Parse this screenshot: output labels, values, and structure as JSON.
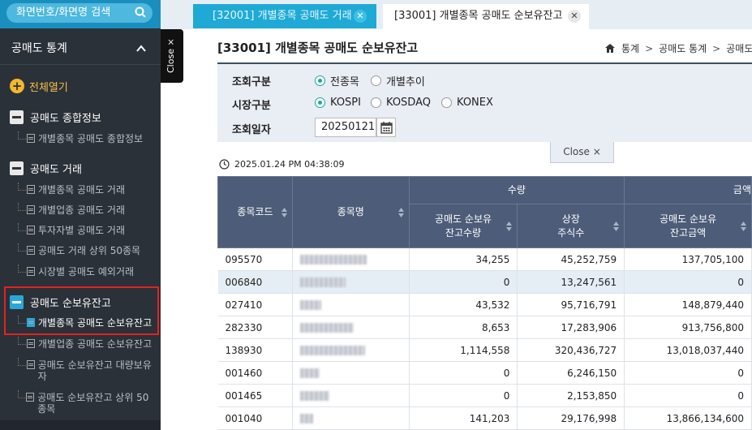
{
  "sidebar": {
    "search_placeholder": "화면번호/화면명 검색",
    "title": "공매도 통계",
    "expand_all": "전체열기",
    "groups": [
      {
        "label": "공매도 종합정보",
        "items": [
          "개별종목 공매도 종합정보"
        ]
      },
      {
        "label": "공매도 거래",
        "items": [
          "개별종목 공매도 거래",
          "개별업종 공매도 거래",
          "투자자별 공매도 거래",
          "공매도 거래 상위 50종목",
          "시장별 공매도 예외거래"
        ]
      },
      {
        "label": "공매도 순보유잔고",
        "items": [
          "개별종목 공매도 순보유잔고",
          "개별업종 공매도 순보유잔고",
          "공매도 순보유잔고 대량보유자",
          "공매도 순보유잔고 상위 50종목"
        ]
      }
    ]
  },
  "close_vertical": "Close ×",
  "tabs": [
    {
      "label": "[32001] 개별종목 공매도 거래"
    },
    {
      "label": "[33001] 개별종목 공매도 순보유잔고"
    }
  ],
  "page": {
    "title": "[33001] 개별종목 공매도 순보유잔고",
    "breadcrumb": [
      "통계",
      "공매도 통계",
      "공매도"
    ]
  },
  "filter": {
    "query_type_label": "조회구분",
    "query_type_options": [
      "전종목",
      "개별추이"
    ],
    "market_label": "시장구분",
    "market_options": [
      "KOSPI",
      "KOSDAQ",
      "KONEX"
    ],
    "date_label": "조회일자",
    "date_value": "20250121"
  },
  "close_horizontal": "Close ×",
  "timestamp": "2025.01.24 PM 04:38:09",
  "table": {
    "headers": {
      "code": "종목코드",
      "name": "종목명",
      "group_qty": "수량",
      "group_amt": "금액",
      "short_qty_1": "공매도 순보유",
      "short_qty_2": "잔고수량",
      "listed_1": "상장",
      "listed_2": "주식수",
      "short_amt_1": "공매도 순보유",
      "short_amt_2": "잔고금액"
    },
    "rows": [
      {
        "code": "095570",
        "qty": "34,255",
        "listed": "45,252,759",
        "amt": "137,705,100"
      },
      {
        "code": "006840",
        "qty": "0",
        "listed": "13,247,561",
        "amt": "0"
      },
      {
        "code": "027410",
        "qty": "43,532",
        "listed": "95,716,791",
        "amt": "148,879,440"
      },
      {
        "code": "282330",
        "qty": "8,653",
        "listed": "17,283,906",
        "amt": "913,756,800"
      },
      {
        "code": "138930",
        "qty": "1,114,558",
        "listed": "320,436,727",
        "amt": "13,018,037,440"
      },
      {
        "code": "001460",
        "qty": "0",
        "listed": "6,246,150",
        "amt": "0"
      },
      {
        "code": "001465",
        "qty": "0",
        "listed": "2,153,850",
        "amt": "0"
      },
      {
        "code": "001040",
        "qty": "141,203",
        "listed": "29,176,998",
        "amt": "13,866,134,600"
      }
    ]
  },
  "colors": {
    "accent": "#1faad6",
    "header": "#4d5c78",
    "sidebar": "#2b3138",
    "highlight": "#e32222"
  }
}
